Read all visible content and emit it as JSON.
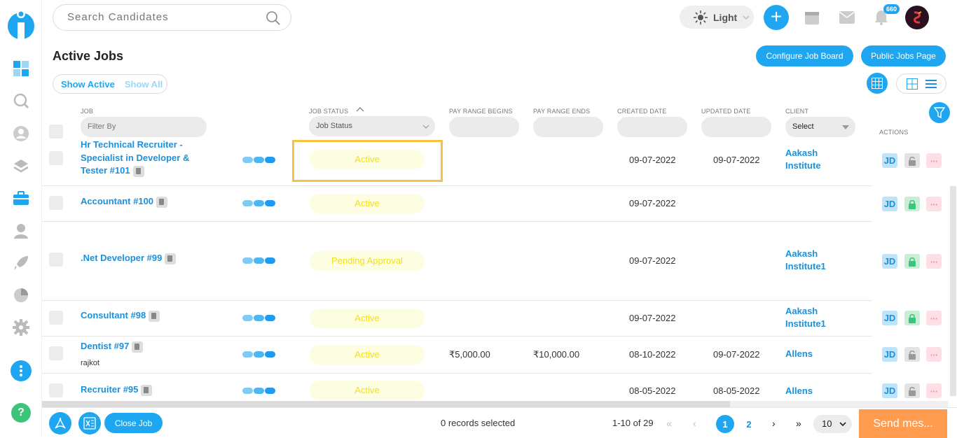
{
  "search": {
    "placeholder": "Search Candidates"
  },
  "header": {
    "theme_label": "Light",
    "notification_count": "660"
  },
  "page": {
    "title": "Active Jobs"
  },
  "buttons": {
    "configure": "Configure Job Board",
    "public": "Public Jobs Page"
  },
  "toggle": {
    "show_active": "Show Active",
    "show_all": "Show All"
  },
  "columns": {
    "job": "Job",
    "job_status": "Job Status",
    "pay_begin": "Pay Range Begins",
    "pay_end": "Pay Range Ends",
    "created": "Created Date",
    "updated": "Updated Date",
    "client": "Client",
    "actions": "Actions"
  },
  "filters": {
    "job_placeholder": "Filter By",
    "status_value": "Job Status",
    "client_value": "Select"
  },
  "rows": [
    {
      "job": "Hr Technical Recruiter - Specialist in Developer & Tester #101",
      "sub": "",
      "status": "Active",
      "pay_begin": "",
      "pay_end": "",
      "created": "09-07-2022",
      "updated": "09-07-2022",
      "client": "Aakash Institute",
      "locked": false
    },
    {
      "job": "Accountant #100",
      "sub": "",
      "status": "Active",
      "pay_begin": "",
      "pay_end": "",
      "created": "09-07-2022",
      "updated": "",
      "client": "",
      "locked": true
    },
    {
      "job": ".Net Developer #99",
      "sub": "",
      "status": "Pending Approval",
      "pay_begin": "",
      "pay_end": "",
      "created": "09-07-2022",
      "updated": "",
      "client": "Aakash Institute1",
      "locked": true
    },
    {
      "job": "Consultant #98",
      "sub": "",
      "status": "Active",
      "pay_begin": "",
      "pay_end": "",
      "created": "09-07-2022",
      "updated": "",
      "client": "Aakash Institute1",
      "locked": true
    },
    {
      "job": "Dentist #97",
      "sub": "rajkot",
      "status": "Active",
      "pay_begin": "₹5,000.00",
      "pay_end": "₹10,000.00",
      "created": "08-10-2022",
      "updated": "09-07-2022",
      "client": "Allens",
      "locked": false
    },
    {
      "job": "Recruiter #95",
      "sub": "",
      "status": "Active",
      "pay_begin": "",
      "pay_end": "",
      "created": "08-05-2022",
      "updated": "08-05-2022",
      "client": "Allens",
      "locked": false
    }
  ],
  "action_labels": {
    "jd": "JD",
    "more": "···"
  },
  "footer": {
    "close_job": "Close Job",
    "selected": "0 records selected",
    "range": "1-10 of 29",
    "page1": "1",
    "page2": "2",
    "per_page": "10",
    "send_message": "Send mes..."
  },
  "colors": {
    "accent": "#1ea7f0",
    "highlight": "#f5c242",
    "status_text": "#f0e020",
    "send": "#ff9c4f"
  }
}
